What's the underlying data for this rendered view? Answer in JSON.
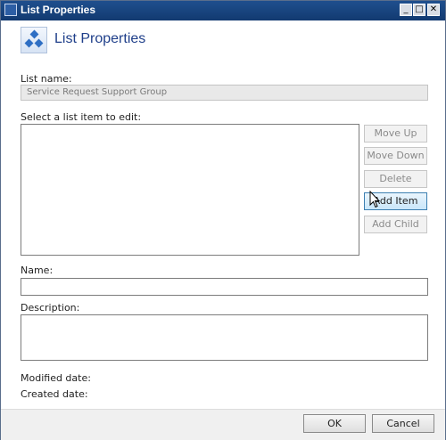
{
  "window": {
    "title": "List Properties",
    "controls": {
      "minimize": "_",
      "maximize": "□",
      "close": "✕"
    },
    "icon": "list-properties-icon"
  },
  "header": {
    "title": "List Properties",
    "icon": "list-hierarchy-icon"
  },
  "form": {
    "list_name_label": "List name:",
    "list_name_value": "Service Request Support Group",
    "select_label": "Select a list item to edit:",
    "list_items": [],
    "name_label": "Name:",
    "name_value": "",
    "description_label": "Description:",
    "description_value": "",
    "modified_label": "Modified date:",
    "created_label": "Created date:"
  },
  "side_buttons": {
    "move_up": "Move Up",
    "move_down": "Move Down",
    "delete": "Delete",
    "add_item": "Add Item",
    "add_child": "Add Child"
  },
  "footer": {
    "ok": "OK",
    "cancel": "Cancel"
  },
  "colors": {
    "titlebar": "#1f4f8e",
    "header_title": "#1f3f8a",
    "highlight_button": "#c9e6f9"
  }
}
